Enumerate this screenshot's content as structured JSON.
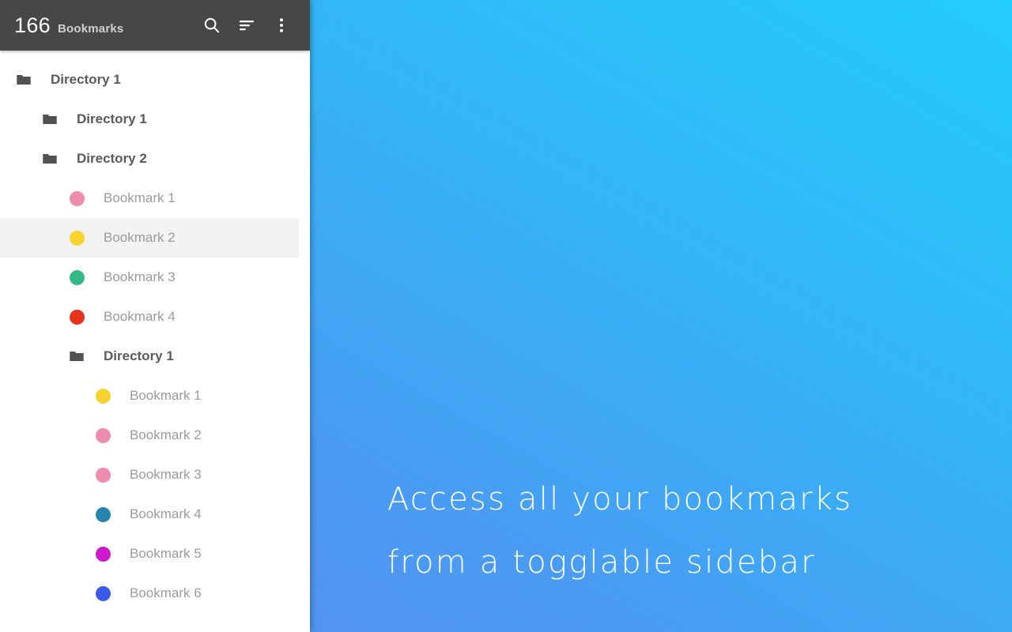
{
  "toolbar": {
    "count": "166",
    "label": "Bookmarks",
    "search_icon": "search-icon",
    "sort_icon": "sort-icon",
    "overflow_icon": "more-vert-icon"
  },
  "promo": {
    "line1": "Access all your bookmarks",
    "line2": "from a togglable sidebar"
  },
  "colors": {
    "toolbar_bg": "#474747",
    "sidebar_bg": "#ffffff",
    "selected_row_bg": "#f2f2f2",
    "folder_text": "#5a5a5a",
    "bookmark_text": "#9b9b9b",
    "folder_icon": "#525252",
    "gradient_start": "#5b8ef0",
    "gradient_end": "#22ccfa"
  },
  "tree": {
    "rows": [
      {
        "type": "folder",
        "indent": 1,
        "label": "Directory 1",
        "color": "#525252",
        "selected": false
      },
      {
        "type": "folder",
        "indent": 2,
        "label": "Directory 1",
        "color": "#525252",
        "selected": false
      },
      {
        "type": "folder",
        "indent": 2,
        "label": "Directory 2",
        "color": "#525252",
        "selected": false
      },
      {
        "type": "bookmark",
        "indent": 3,
        "label": "Bookmark 1",
        "color": "#f08bb0",
        "selected": false
      },
      {
        "type": "bookmark",
        "indent": 3,
        "label": "Bookmark 2",
        "color": "#f6d32d",
        "selected": true
      },
      {
        "type": "bookmark",
        "indent": 3,
        "label": "Bookmark 3",
        "color": "#34b987",
        "selected": false
      },
      {
        "type": "bookmark",
        "indent": 3,
        "label": "Bookmark 4",
        "color": "#e8321c",
        "selected": false
      },
      {
        "type": "folder",
        "indent": 3,
        "label": "Directory 1",
        "color": "#525252",
        "selected": false
      },
      {
        "type": "bookmark",
        "indent": 4,
        "label": "Bookmark 1",
        "color": "#f6d32d",
        "selected": false
      },
      {
        "type": "bookmark",
        "indent": 4,
        "label": "Bookmark 2",
        "color": "#f08bb0",
        "selected": false
      },
      {
        "type": "bookmark",
        "indent": 4,
        "label": "Bookmark 3",
        "color": "#f08bb0",
        "selected": false
      },
      {
        "type": "bookmark",
        "indent": 4,
        "label": "Bookmark 4",
        "color": "#2583ad",
        "selected": false
      },
      {
        "type": "bookmark",
        "indent": 4,
        "label": "Bookmark 5",
        "color": "#ce19d1",
        "selected": false
      },
      {
        "type": "bookmark",
        "indent": 4,
        "label": "Bookmark 6",
        "color": "#3a5ae8",
        "selected": false
      }
    ]
  }
}
